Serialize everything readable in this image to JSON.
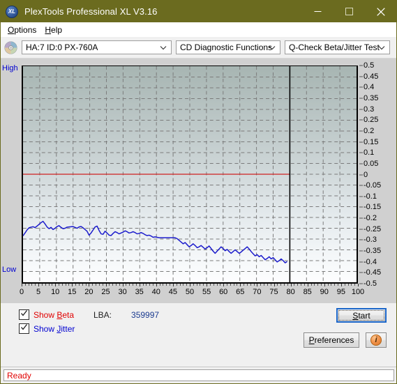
{
  "window": {
    "title": "PlexTools Professional XL V3.16",
    "logo_text": "XL",
    "minimize_icon": "minimize-icon",
    "maximize_icon": "maximize-icon",
    "close_icon": "close-icon"
  },
  "menu": {
    "items": [
      {
        "label": "Options",
        "accel": "O"
      },
      {
        "label": "Help",
        "accel": "H"
      }
    ]
  },
  "toolbar": {
    "disc_icon": "optical-disc-icon",
    "drive_selector": {
      "value": "HA:7 ID:0  PX-760A",
      "arrow_icon": "chevron-down-icon"
    },
    "function_selector": {
      "value": "CD Diagnostic Functions",
      "arrow_icon": "chevron-down-icon"
    },
    "test_selector": {
      "value": "Q-Check Beta/Jitter Test",
      "arrow_icon": "chevron-down-icon"
    }
  },
  "chart_data": {
    "type": "line",
    "title": "Q-Check Beta/Jitter Test",
    "xlabel": "",
    "ylabel": "",
    "xlim": [
      0,
      100
    ],
    "ylim": [
      -0.5,
      0.5
    ],
    "grid": true,
    "legend_position": "none",
    "y_axis_side": "right",
    "y_left_top_label": "High",
    "y_left_bottom_label": "Low",
    "y_ticks": [
      0.5,
      0.45,
      0.4,
      0.35,
      0.3,
      0.25,
      0.2,
      0.15,
      0.1,
      0.05,
      0,
      -0.05,
      -0.1,
      -0.15,
      -0.2,
      -0.25,
      -0.3,
      -0.35,
      -0.4,
      -0.45,
      -0.5
    ],
    "x_ticks": [
      0,
      5,
      10,
      15,
      20,
      25,
      30,
      35,
      40,
      45,
      50,
      55,
      60,
      65,
      70,
      75,
      80,
      85,
      90,
      95,
      100
    ],
    "zero_reference_line": {
      "value": 0,
      "color": "#d02020",
      "x_end": 80
    },
    "data_end_marker": {
      "x": 80,
      "color": "#000000"
    },
    "series": [
      {
        "name": "Beta",
        "color": "#1a1acc",
        "x": [
          0,
          0.6,
          1.2,
          1.8,
          2.4,
          3.0,
          3.6,
          4.2,
          4.8,
          5.4,
          6.0,
          6.6,
          7.2,
          7.8,
          8.4,
          9.0,
          9.6,
          10.2,
          10.8,
          11.4,
          12.0,
          12.6,
          13.2,
          13.8,
          14.4,
          15.0,
          15.6,
          16.2,
          16.8,
          17.4,
          18.0,
          18.6,
          19.2,
          19.8,
          20.4,
          21.0,
          21.6,
          22.2,
          22.8,
          23.4,
          24.0,
          24.6,
          25.2,
          25.8,
          26.4,
          27.0,
          27.6,
          28.2,
          28.8,
          29.4,
          30.0,
          30.6,
          31.2,
          31.8,
          32.4,
          33.0,
          33.6,
          34.2,
          34.8,
          35.4,
          36.0,
          36.6,
          37.2,
          37.8,
          38.4,
          39.0,
          39.6,
          40.2,
          40.8,
          41.4,
          42.0,
          42.6,
          43.2,
          43.8,
          44.4,
          45.0,
          45.6,
          46.2,
          46.8,
          47.4,
          48.0,
          48.6,
          49.2,
          49.8,
          50.4,
          51.0,
          51.6,
          52.2,
          52.8,
          53.4,
          54.0,
          54.6,
          55.2,
          55.8,
          56.4,
          57.0,
          57.6,
          58.2,
          58.8,
          59.4,
          60.0,
          60.6,
          61.2,
          61.8,
          62.4,
          63.0,
          63.6,
          64.2,
          64.8,
          65.4,
          66.0,
          66.6,
          67.2,
          67.8,
          68.4,
          69.0,
          69.6,
          70.2,
          70.8,
          71.4,
          72.0,
          72.6,
          73.2,
          73.8,
          74.4,
          75.0,
          75.6,
          76.2,
          76.8,
          77.4,
          78.0,
          78.6,
          79.2,
          79.8
        ],
        "y": [
          -0.285,
          -0.272,
          -0.258,
          -0.248,
          -0.245,
          -0.243,
          -0.247,
          -0.24,
          -0.232,
          -0.224,
          -0.218,
          -0.23,
          -0.244,
          -0.252,
          -0.246,
          -0.256,
          -0.25,
          -0.242,
          -0.238,
          -0.246,
          -0.252,
          -0.25,
          -0.245,
          -0.244,
          -0.243,
          -0.242,
          -0.246,
          -0.25,
          -0.244,
          -0.242,
          -0.248,
          -0.256,
          -0.264,
          -0.282,
          -0.272,
          -0.258,
          -0.244,
          -0.24,
          -0.26,
          -0.276,
          -0.278,
          -0.264,
          -0.272,
          -0.282,
          -0.284,
          -0.274,
          -0.266,
          -0.27,
          -0.276,
          -0.272,
          -0.268,
          -0.262,
          -0.266,
          -0.272,
          -0.27,
          -0.266,
          -0.27,
          -0.276,
          -0.274,
          -0.27,
          -0.274,
          -0.28,
          -0.284,
          -0.282,
          -0.286,
          -0.292,
          -0.29,
          -0.292,
          -0.294,
          -0.294,
          -0.294,
          -0.294,
          -0.294,
          -0.294,
          -0.294,
          -0.294,
          -0.294,
          -0.298,
          -0.306,
          -0.314,
          -0.322,
          -0.316,
          -0.326,
          -0.336,
          -0.33,
          -0.322,
          -0.33,
          -0.34,
          -0.336,
          -0.33,
          -0.338,
          -0.346,
          -0.34,
          -0.332,
          -0.344,
          -0.356,
          -0.366,
          -0.356,
          -0.346,
          -0.336,
          -0.344,
          -0.354,
          -0.348,
          -0.358,
          -0.366,
          -0.358,
          -0.35,
          -0.358,
          -0.366,
          -0.36,
          -0.352,
          -0.344,
          -0.336,
          -0.346,
          -0.358,
          -0.368,
          -0.378,
          -0.372,
          -0.382,
          -0.376,
          -0.386,
          -0.396,
          -0.39,
          -0.382,
          -0.392,
          -0.386,
          -0.396,
          -0.406,
          -0.4,
          -0.392,
          -0.4,
          -0.41,
          -0.404
        ],
        "data_end_x": 80
      }
    ]
  },
  "controls": {
    "show_beta": {
      "label_prefix": "Show ",
      "label_accel": "B",
      "label_suffix": "eta",
      "checked": true
    },
    "show_jitter": {
      "label_prefix": "Show ",
      "label_accel": "J",
      "label_suffix": "itter",
      "checked": true
    },
    "lba": {
      "label": "LBA:",
      "value": "359997"
    },
    "start_button": {
      "label_accel": "S",
      "label_suffix": "tart",
      "focused": true
    },
    "preferences_button": {
      "label_accel": "P",
      "label_suffix": "references"
    },
    "info_button": {
      "icon": "info-icon",
      "glyph": "i"
    }
  },
  "status": {
    "text": "Ready"
  },
  "colors": {
    "title_bar": "#6b6b1f",
    "series_beta": "#1a1acc",
    "zero_line": "#d02020",
    "status_text": "#e00000",
    "label_blue": "#0000d0",
    "focus_border": "#1b66c9"
  }
}
